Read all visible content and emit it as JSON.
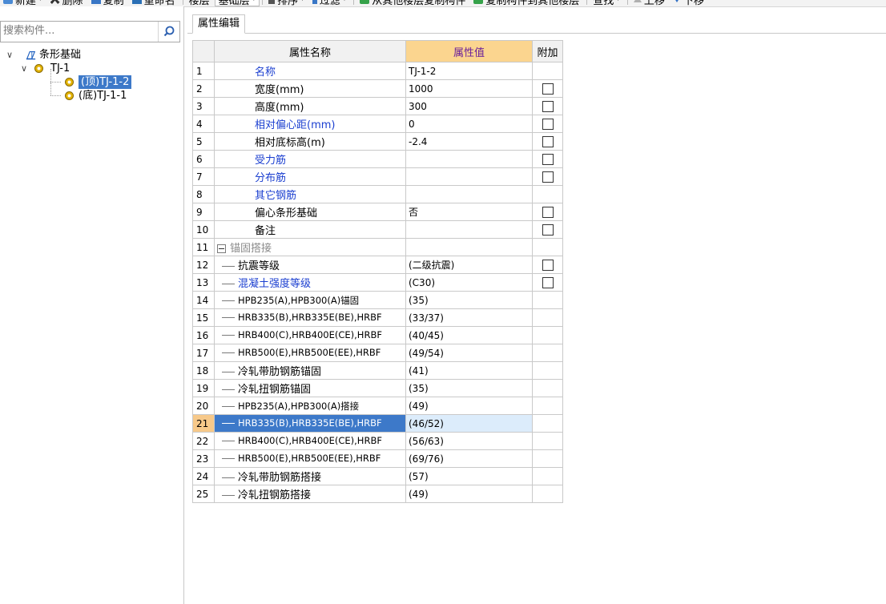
{
  "toolbar": {
    "items": [
      {
        "label": "新建",
        "icon": "new-icon",
        "dropdown": true
      },
      {
        "label": "删除",
        "icon": "delete-icon"
      },
      {
        "label": "复制",
        "icon": "copy-icon"
      },
      {
        "label": "重命名",
        "icon": "rename-icon"
      },
      {
        "label": "楼层",
        "icon": ""
      },
      {
        "label": "基础层",
        "combo": true
      },
      {
        "label": "排序",
        "icon": "sort-icon",
        "dropdown": true
      },
      {
        "label": "过滤",
        "icon": "filter-icon",
        "dropdown": true
      },
      {
        "label": "从其他楼层复制构件",
        "icon": "copy-from-floor-icon"
      },
      {
        "label": "复制构件到其他楼层",
        "icon": "copy-to-floor-icon"
      },
      {
        "label": "查找",
        "dropdown": true
      },
      {
        "label": "上移",
        "icon": "move-up-icon"
      },
      {
        "label": "下移",
        "icon": "move-down-icon"
      }
    ]
  },
  "search": {
    "placeholder": "搜索构件..."
  },
  "tree": {
    "root": "条形基础",
    "child": "TJ-1",
    "leaves": [
      "(顶)TJ-1-2",
      "(底)TJ-1-1"
    ],
    "selected_leaf": "(顶)TJ-1-2"
  },
  "tab": {
    "label": "属性编辑"
  },
  "grid": {
    "headers": {
      "num": "",
      "name": "属性名称",
      "value": "属性值",
      "extra": "附加"
    },
    "selected_row": 21,
    "rows": [
      {
        "num": "1",
        "name": "名称",
        "value": "TJ-1-2",
        "style": "blue",
        "checkbox": false
      },
      {
        "num": "2",
        "name": "宽度(mm)",
        "value": "1000",
        "style": "",
        "checkbox": true
      },
      {
        "num": "3",
        "name": "高度(mm)",
        "value": "300",
        "style": "",
        "checkbox": true
      },
      {
        "num": "4",
        "name": "相对偏心距(mm)",
        "value": "0",
        "style": "blue",
        "checkbox": true
      },
      {
        "num": "5",
        "name": "相对底标高(m)",
        "value": "-2.4",
        "style": "",
        "checkbox": true
      },
      {
        "num": "6",
        "name": "受力筋",
        "value": "",
        "style": "blue",
        "checkbox": true
      },
      {
        "num": "7",
        "name": "分布筋",
        "value": "",
        "style": "blue",
        "checkbox": true
      },
      {
        "num": "8",
        "name": "其它钢筋",
        "value": "",
        "style": "blue",
        "checkbox": false
      },
      {
        "num": "9",
        "name": "偏心条形基础",
        "value": "否",
        "style": "",
        "checkbox": true
      },
      {
        "num": "10",
        "name": "备注",
        "value": "",
        "style": "",
        "checkbox": true
      },
      {
        "num": "11",
        "name": "锚固搭接",
        "value": "",
        "style": "group",
        "checkbox": false
      },
      {
        "num": "12",
        "name": "抗震等级",
        "value": "(二级抗震)",
        "style": "child",
        "checkbox": true
      },
      {
        "num": "13",
        "name": "混凝土强度等级",
        "value": "(C30)",
        "style": "child-blue",
        "checkbox": true
      },
      {
        "num": "14",
        "name": "HPB235(A),HPB300(A)锚固",
        "value": "(35)",
        "style": "child-small",
        "checkbox": false
      },
      {
        "num": "15",
        "name": "HRB335(B),HRB335E(BE),HRBF",
        "value": "(33/37)",
        "style": "child-small",
        "checkbox": false
      },
      {
        "num": "16",
        "name": "HRB400(C),HRB400E(CE),HRBF",
        "value": "(40/45)",
        "style": "child-small",
        "checkbox": false
      },
      {
        "num": "17",
        "name": "HRB500(E),HRB500E(EE),HRBF",
        "value": "(49/54)",
        "style": "child-small",
        "checkbox": false
      },
      {
        "num": "18",
        "name": "冷轧带肋钢筋锚固",
        "value": "(41)",
        "style": "child",
        "checkbox": false
      },
      {
        "num": "19",
        "name": "冷轧扭钢筋锚固",
        "value": "(35)",
        "style": "child",
        "checkbox": false
      },
      {
        "num": "20",
        "name": "HPB235(A),HPB300(A)搭接",
        "value": "(49)",
        "style": "child-small",
        "checkbox": false
      },
      {
        "num": "21",
        "name": "HRB335(B),HRB335E(BE),HRBF",
        "value": "(46/52)",
        "style": "child-small",
        "checkbox": false
      },
      {
        "num": "22",
        "name": "HRB400(C),HRB400E(CE),HRBF",
        "value": "(56/63)",
        "style": "child-small",
        "checkbox": false
      },
      {
        "num": "23",
        "name": "HRB500(E),HRB500E(EE),HRBF",
        "value": "(69/76)",
        "style": "child-small",
        "checkbox": false
      },
      {
        "num": "24",
        "name": "冷轧带肋钢筋搭接",
        "value": "(57)",
        "style": "child",
        "checkbox": false
      },
      {
        "num": "25",
        "name": "冷轧扭钢筋搭接",
        "value": "(49)",
        "style": "child",
        "checkbox": false
      }
    ]
  },
  "colors": {
    "accent": "#3d79c9",
    "header_value_bg": "#fbd58f",
    "link_blue": "#1b3fd0"
  }
}
